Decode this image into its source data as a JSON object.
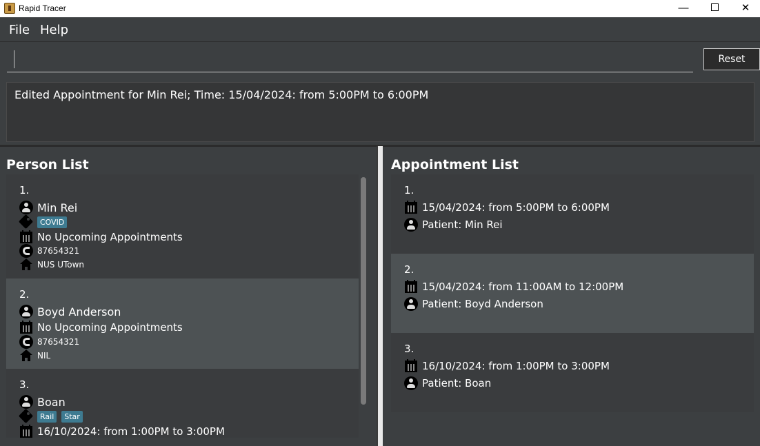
{
  "window": {
    "title": "Rapid Tracer",
    "minimize_glyph": "—",
    "close_glyph": "✕"
  },
  "menu": {
    "file": "File",
    "help": "Help"
  },
  "command": {
    "value": "",
    "reset_label": "Reset"
  },
  "result": {
    "text": "Edited Appointment for Min Rei; Time: 15/04/2024: from 5:00PM to 6:00PM"
  },
  "person_list": {
    "title": "Person List",
    "persons": [
      {
        "index": "1.",
        "name": "Min Rei",
        "tags": [
          "COVID"
        ],
        "appointment": "No Upcoming Appointments",
        "phone": "87654321",
        "address": "NUS UTown"
      },
      {
        "index": "2.",
        "name": "Boyd Anderson",
        "tags": [],
        "appointment": "No Upcoming Appointments",
        "phone": "87654321",
        "address": "NIL"
      },
      {
        "index": "3.",
        "name": "Boan",
        "tags": [
          "Rail",
          "Star"
        ],
        "appointment": "16/10/2024: from 1:00PM to 3:00PM",
        "phone": "",
        "address": ""
      }
    ]
  },
  "appointment_list": {
    "title": "Appointment List",
    "appointments": [
      {
        "index": "1.",
        "time": "15/04/2024: from 5:00PM to 6:00PM",
        "patient": "Patient: Min Rei"
      },
      {
        "index": "2.",
        "time": "15/04/2024: from 11:00AM to 12:00PM",
        "patient": "Patient: Boyd Anderson"
      },
      {
        "index": "3.",
        "time": "16/10/2024: from 1:00PM to 3:00PM",
        "patient": "Patient: Boan"
      }
    ]
  },
  "colors": {
    "background": "#3c3f41",
    "selected_card": "#4d5254",
    "tag": "#3e7b91"
  },
  "icons": {
    "person": "person-icon",
    "calendar": "calendar-icon",
    "tag": "tag-icon",
    "phone": "phone-icon",
    "home": "home-icon"
  }
}
